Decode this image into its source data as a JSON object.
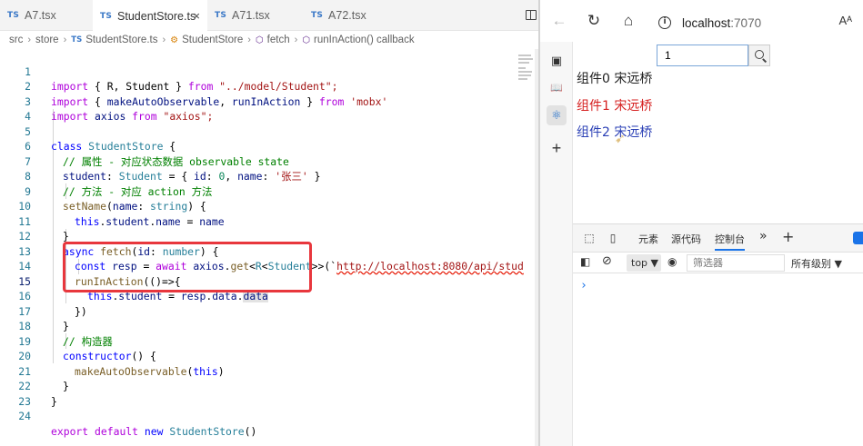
{
  "editor": {
    "tabs": [
      {
        "badge": "TS",
        "label": "A7.tsx"
      },
      {
        "badge": "TS",
        "label": "StudentStore.ts",
        "close": "×"
      },
      {
        "badge": "TS",
        "label": "A71.tsx"
      },
      {
        "badge": "TS",
        "label": "A72.tsx"
      }
    ],
    "breadcrumb": {
      "items": [
        "src",
        "store",
        "StudentStore.ts",
        "StudentStore",
        "fetch",
        "runInAction() callback"
      ],
      "ts_badge": "TS",
      "sep": "›"
    },
    "lines": [
      "1",
      "2",
      "3",
      "4",
      "5",
      "6",
      "7",
      "8",
      "9",
      "10",
      "11",
      "12",
      "13",
      "14",
      "15",
      "16",
      "17",
      "18",
      "19",
      "20",
      "21",
      "22",
      "23",
      "24"
    ],
    "code": {
      "l1": {
        "a": "import",
        "b": " { R, Student } ",
        "c": "from",
        "d": " \"../model/Student\";"
      },
      "l2": {
        "a": "import",
        "b": " { ",
        "c": "makeAutoObservable",
        "d": ", ",
        "e": "runInAction",
        "f": " } ",
        "g": "from",
        "h": " 'mobx'"
      },
      "l3": {
        "a": "import",
        "b": " axios ",
        "c": "from",
        "d": " \"axios\";"
      },
      "l5": {
        "a": "class",
        "b": " StudentStore",
        "c": " {"
      },
      "l6": "// 属性 - 对应状态数据 observable state",
      "l7": {
        "a": "student",
        "b": ": ",
        "c": "Student",
        "d": " = { ",
        "e": "id",
        "f": ": ",
        "g": "0",
        "h": ", ",
        "i": "name",
        "j": ": ",
        "k": "'张三'",
        "l": " }"
      },
      "l8": "// 方法 - 对应 action 方法",
      "l9": {
        "a": "setName",
        "b": "(",
        "c": "name",
        "d": ": ",
        "e": "string",
        "f": ") {"
      },
      "l10": {
        "a": "this",
        "b": ".",
        "c": "student",
        "d": ".",
        "e": "name",
        "f": " = ",
        "g": "name"
      },
      "l11": "}",
      "l12": {
        "a": "async",
        "b": " ",
        "c": "fetch",
        "d": "(",
        "e": "id",
        "f": ": ",
        "g": "number",
        "h": ") {"
      },
      "l13": {
        "a": "const",
        "b": " ",
        "c": "resp",
        "d": " = ",
        "e": "await",
        "f": " ",
        "g": "axios",
        "h": ".",
        "i": "get",
        "j": "<",
        "k": "R",
        "l": "<",
        "m": "Student",
        "n": ">>(`",
        "o": "http://localhost:8080/api/stud"
      },
      "l14": {
        "a": "runInAction",
        "b": "(()=>{"
      },
      "l15": {
        "a": "this",
        "b": ".",
        "c": "student",
        "d": " = ",
        "e": "resp",
        "f": ".",
        "g": "data",
        "h": ".",
        "i": "data"
      },
      "l16": "})",
      "l17": "}",
      "l18": "// 构造器",
      "l19": {
        "a": "constructor",
        "b": "() {"
      },
      "l20": {
        "a": "makeAutoObservable",
        "b": "(",
        "c": "this",
        "d": ")"
      },
      "l21": "}",
      "l22": "}",
      "l24": {
        "a": "export",
        "b": " ",
        "c": "default",
        "d": " ",
        "e": "new",
        "f": " ",
        "g": "StudentStore",
        "h": "()"
      }
    }
  },
  "browser": {
    "nav": {
      "back": "←",
      "reload": "↻",
      "home": "⌂"
    },
    "address": {
      "host": "localhost",
      "port": ":7070",
      "info": "i"
    },
    "read_aloud": "Aᴬ",
    "sidebar_icons": [
      "▣",
      "📖",
      "⚛",
      "+"
    ],
    "page": {
      "search_value": "1",
      "components": [
        {
          "label": "组件0 宋远桥",
          "color": "#1f1f1f"
        },
        {
          "label": "组件1 宋远桥",
          "color": "#d62020"
        },
        {
          "label": "组件2 宋远桥",
          "color": "#2a3fb5"
        }
      ]
    },
    "devtools": {
      "tabs": [
        "元素",
        "源代码",
        "控制台"
      ],
      "more": "»",
      "add": "+",
      "context": "top ▼",
      "filter_placeholder": "筛选器",
      "levels": "所有级别 ▼",
      "prompt": "›"
    }
  }
}
